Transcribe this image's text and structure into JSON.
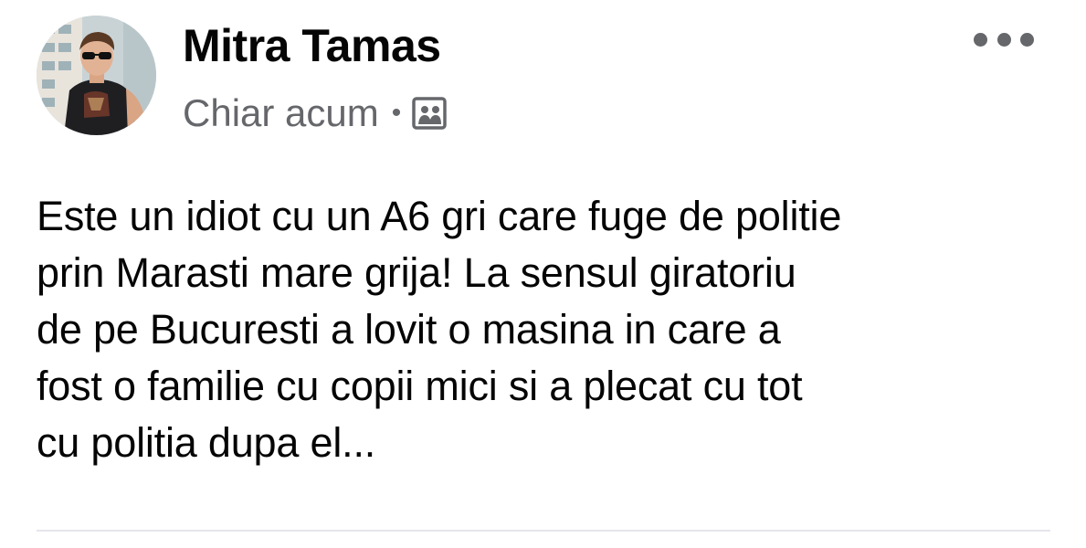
{
  "post": {
    "author_name": "Mitra Tamas",
    "timestamp": "Chiar acum",
    "separator": "•",
    "audience_icon": "photo-audience-icon",
    "more_icon": "more-options-icon",
    "text": "Este un idiot cu un A6 gri care fuge de politie\nprin Marasti mare grija! La sensul giratoriu\nde pe Bucuresti a lovit o masina in care a\nfost o familie cu copii mici si a plecat cu tot\ncu politia dupa el..."
  },
  "colors": {
    "text_primary": "#050505",
    "text_secondary": "#65676b",
    "divider": "#e4e6eb",
    "background": "#ffffff"
  }
}
